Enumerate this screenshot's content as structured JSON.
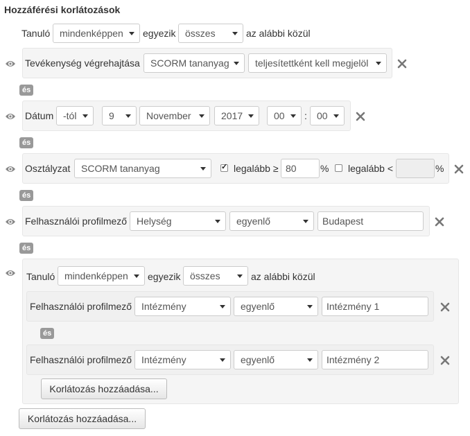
{
  "title": "Hozzáférési korlátozások",
  "top_condition": {
    "prefix": "Tanuló",
    "mode": "mindenképpen",
    "verb": "egyezik",
    "scope": "összes",
    "suffix": "az alábbi közül"
  },
  "and_label": "és",
  "r1": {
    "label": "Tevékenység végrehajtása",
    "activity": "SCORM tananyag",
    "condition": "teljesítettként kell megjelöl"
  },
  "r2": {
    "label": "Dátum",
    "direction": "-tól",
    "day": "9",
    "month": "November",
    "year": "2017",
    "hour": "00",
    "colon": ":",
    "minute": "00"
  },
  "r3": {
    "label": "Osztályzat",
    "item": "SCORM tananyag",
    "min_label": "legalább ≥",
    "min_value": "80",
    "percent": "%",
    "max_label": "legalább <",
    "max_value": "",
    "min_checked": true,
    "max_checked": false
  },
  "r4": {
    "label": "Felhasználói profilmező",
    "field": "Helység",
    "operator": "egyenlő",
    "value": "Budapest"
  },
  "nested": {
    "prefix": "Tanuló",
    "mode": "mindenképpen",
    "verb": "egyezik",
    "scope": "összes",
    "suffix": "az alábbi közül",
    "n1": {
      "label": "Felhasználói profilmező",
      "field": "Intézmény",
      "operator": "egyenlő",
      "value": "Intézmény 1"
    },
    "n2": {
      "label": "Felhasználói profilmező",
      "field": "Intézmény",
      "operator": "egyenlő",
      "value": "Intézmény 2"
    },
    "add_button": "Korlátozás hozzáadása..."
  },
  "add_button": "Korlátozás hozzáadása...",
  "icons": {
    "eye": "eye-icon",
    "delete": "close-icon"
  }
}
